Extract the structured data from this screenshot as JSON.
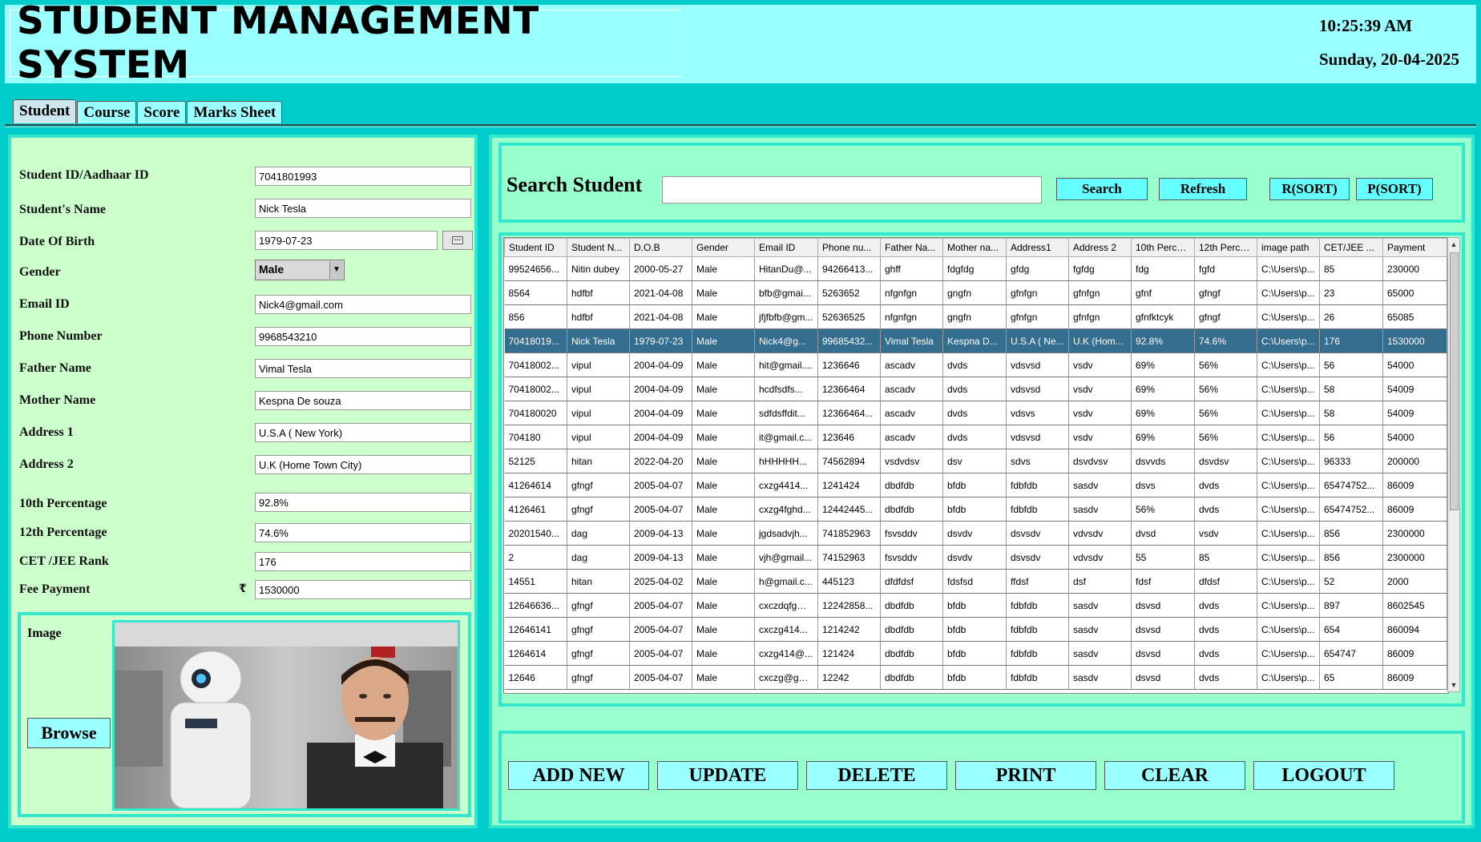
{
  "header": {
    "title": "STUDENT MANAGEMENT SYSTEM",
    "time": "10:25:39 AM",
    "date": "Sunday, 20-04-2025"
  },
  "tabs": [
    {
      "label": "Student"
    },
    {
      "label": "Course"
    },
    {
      "label": "Score"
    },
    {
      "label": "Marks Sheet"
    }
  ],
  "form": {
    "student_id": {
      "label": "Student ID/Aadhaar ID",
      "value": "7041801993"
    },
    "name": {
      "label": "Student's Name",
      "value": "Nick Tesla"
    },
    "dob": {
      "label": "Date Of Birth",
      "value": "1979-07-23"
    },
    "gender": {
      "label": "Gender",
      "value": "Male"
    },
    "email": {
      "label": "Email ID",
      "value": "Nick4@gmail.com"
    },
    "phone": {
      "label": "Phone Number",
      "value": "9968543210"
    },
    "father": {
      "label": "Father Name",
      "value": "Vimal Tesla"
    },
    "mother": {
      "label": "Mother Name",
      "value": "Kespna De souza"
    },
    "address1": {
      "label": "Address 1",
      "value": "U.S.A ( New York)"
    },
    "address2": {
      "label": "Address 2",
      "value": "U.K (Home Town City)"
    },
    "tenth": {
      "label": "10th Percentage",
      "value": "92.8%"
    },
    "twelfth": {
      "label": "12th Percentage",
      "value": "74.6%"
    },
    "cet": {
      "label": "CET /JEE Rank",
      "value": "176"
    },
    "fee": {
      "label": "Fee Payment",
      "value": "1530000",
      "currency": "₹"
    },
    "image_label": "Image",
    "browse_label": "Browse"
  },
  "search": {
    "title": "Search Student",
    "value": "",
    "search_label": "Search",
    "refresh_label": "Refresh",
    "rsort_label": "R(SORT)",
    "psort_label": "P(SORT)"
  },
  "table": {
    "columns": [
      "Student ID",
      "Student N...",
      "D.O.B",
      "Gender",
      "Email ID",
      "Phone nu...",
      "Father Na...",
      "Mother na...",
      "Address1",
      "Address 2",
      "10th Perce...",
      "12th Perce...",
      "image path",
      "CET/JEE ...",
      "Payment"
    ],
    "selected_index": 3,
    "rows": [
      [
        "99524656...",
        "Nitin dubey",
        "2000-05-27",
        "Male",
        "HitanDu@...",
        "94266413...",
        "ghff",
        "fdgfdg",
        "gfdg",
        "fgfdg",
        "fdg",
        "fgfd",
        "C:\\Users\\p...",
        "85",
        "230000"
      ],
      [
        "8564",
        "hdfbf",
        "2021-04-08",
        "Male",
        "bfb@gmai...",
        "5263652",
        "nfgnfgn",
        "gngfn",
        "gfnfgn",
        "gfnfgn",
        "gfnf",
        "gfngf",
        "C:\\Users\\p...",
        "23",
        "65000"
      ],
      [
        "856",
        "hdfbf",
        "2021-04-08",
        "Male",
        "jfjfbfb@gm...",
        "52636525",
        "nfgnfgn",
        "gngfn",
        "gfnfgn",
        "gfnfgn",
        "gfnfktcyk",
        "gfngf",
        "C:\\Users\\p...",
        "26",
        "65085"
      ],
      [
        "70418019...",
        "Nick Tesla",
        "1979-07-23",
        "Male",
        "Nick4@g...",
        "99685432...",
        "Vimal Tesla",
        "Kespna D...",
        "U.S.A ( Ne...",
        "U.K (Hom...",
        "92.8%",
        "74.6%",
        "C:\\Users\\p...",
        "176",
        "1530000"
      ],
      [
        "70418002...",
        "vipul",
        "2004-04-09",
        "Male",
        "hit@gmail....",
        "1236646",
        "ascadv",
        "dvds",
        "vdsvsd",
        "vsdv",
        "69%",
        "56%",
        "C:\\Users\\p...",
        "56",
        "54000"
      ],
      [
        "70418002...",
        "vipul",
        "2004-04-09",
        "Male",
        "hcdfsdfs...",
        "12366464",
        "ascadv",
        "dvds",
        "vdsvsd",
        "vsdv",
        "69%",
        "56%",
        "C:\\Users\\p...",
        "58",
        "54009"
      ],
      [
        "704180020",
        "vipul",
        "2004-04-09",
        "Male",
        "sdfdsffdit...",
        "12366464...",
        "ascadv",
        "dvds",
        "vdsvs",
        "vsdv",
        "69%",
        "56%",
        "C:\\Users\\p...",
        "58",
        "54009"
      ],
      [
        "704180",
        "vipul",
        "2004-04-09",
        "Male",
        "it@gmail.c...",
        "123646",
        "ascadv",
        "dvds",
        "vdsvsd",
        "vsdv",
        "69%",
        "56%",
        "C:\\Users\\p...",
        "56",
        "54000"
      ],
      [
        "52125",
        "hitan",
        "2022-04-20",
        "Male",
        "hHHHHH...",
        "74562894",
        "vsdvdsv",
        "dsv",
        "sdvs",
        "dsvdvsv",
        "dsvvds",
        "dsvdsv",
        "C:\\Users\\p...",
        "96333",
        "200000"
      ],
      [
        "41264614",
        "gfngf",
        "2005-04-07",
        "Male",
        "cxzg4414...",
        "1241424",
        "dbdfdb",
        "bfdb",
        "fdbfdb",
        "sasdv",
        "dsvs",
        "dvds",
        "C:\\Users\\p...",
        "65474752...",
        "86009"
      ],
      [
        "4126461",
        "gfngf",
        "2005-04-07",
        "Male",
        "cxzg4fghd...",
        "12442445...",
        "dbdfdb",
        "bfdb",
        "fdbfdb",
        "sasdv",
        "56%",
        "dvds",
        "C:\\Users\\p...",
        "65474752...",
        "86009"
      ],
      [
        "20201540...",
        "dag",
        "2009-04-13",
        "Male",
        "jgdsadvjh...",
        "741852963",
        "fsvsddv",
        "dsvdv",
        "dsvsdv",
        "vdvsdv",
        "dvsd",
        "vsdv",
        "C:\\Users\\p...",
        "856",
        "2300000"
      ],
      [
        "2",
        "dag",
        "2009-04-13",
        "Male",
        "vjh@gmail...",
        "74152963",
        "fsvsddv",
        "dsvdv",
        "dsvsdv",
        "vdvsdv",
        "55",
        "85",
        "C:\\Users\\p...",
        "856",
        "2300000"
      ],
      [
        "14551",
        "hitan",
        "2025-04-02",
        "Male",
        "h@gmail.c...",
        "445123",
        "dfdfdsf",
        "fdsfsd",
        "ffdsf",
        "dsf",
        "fdsf",
        "dfdsf",
        "C:\\Users\\p...",
        "52",
        "2000"
      ],
      [
        "12646636...",
        "gfngf",
        "2005-04-07",
        "Male",
        "cxczdqfg@...",
        "12242858...",
        "dbdfdb",
        "bfdb",
        "fdbfdb",
        "sasdv",
        "dsvsd",
        "dvds",
        "C:\\Users\\p...",
        "897",
        "8602545"
      ],
      [
        "12646141",
        "gfngf",
        "2005-04-07",
        "Male",
        "cxczg414...",
        "1214242",
        "dbdfdb",
        "bfdb",
        "fdbfdb",
        "sasdv",
        "dsvsd",
        "dvds",
        "C:\\Users\\p...",
        "654",
        "860094"
      ],
      [
        "1264614",
        "gfngf",
        "2005-04-07",
        "Male",
        "cxzg414@...",
        "121424",
        "dbdfdb",
        "bfdb",
        "fdbfdb",
        "sasdv",
        "dsvsd",
        "dvds",
        "C:\\Users\\p...",
        "654747",
        "86009"
      ],
      [
        "12646",
        "gfngf",
        "2005-04-07",
        "Male",
        "cxczg@gm...",
        "12242",
        "dbdfdb",
        "bfdb",
        "fdbfdb",
        "sasdv",
        "dsvsd",
        "dvds",
        "C:\\Users\\p...",
        "65",
        "86009"
      ]
    ]
  },
  "actions": {
    "add_label": "ADD NEW",
    "update_label": "UPDATE",
    "delete_label": "DELETE",
    "print_label": "PRINT",
    "clear_label": "CLEAR",
    "logout_label": "LOGOUT"
  },
  "colors": {
    "background": "#00cccc",
    "header": "#99ffff",
    "left_panel": "#ccffcc",
    "right_panel": "#99ffcc",
    "border_accent": "#33e6cc",
    "selected_row": "#356d8f"
  },
  "icons": {
    "date_picker": "calendar-icon",
    "dropdown": "chevron-down-icon",
    "currency": "rupee-icon"
  }
}
